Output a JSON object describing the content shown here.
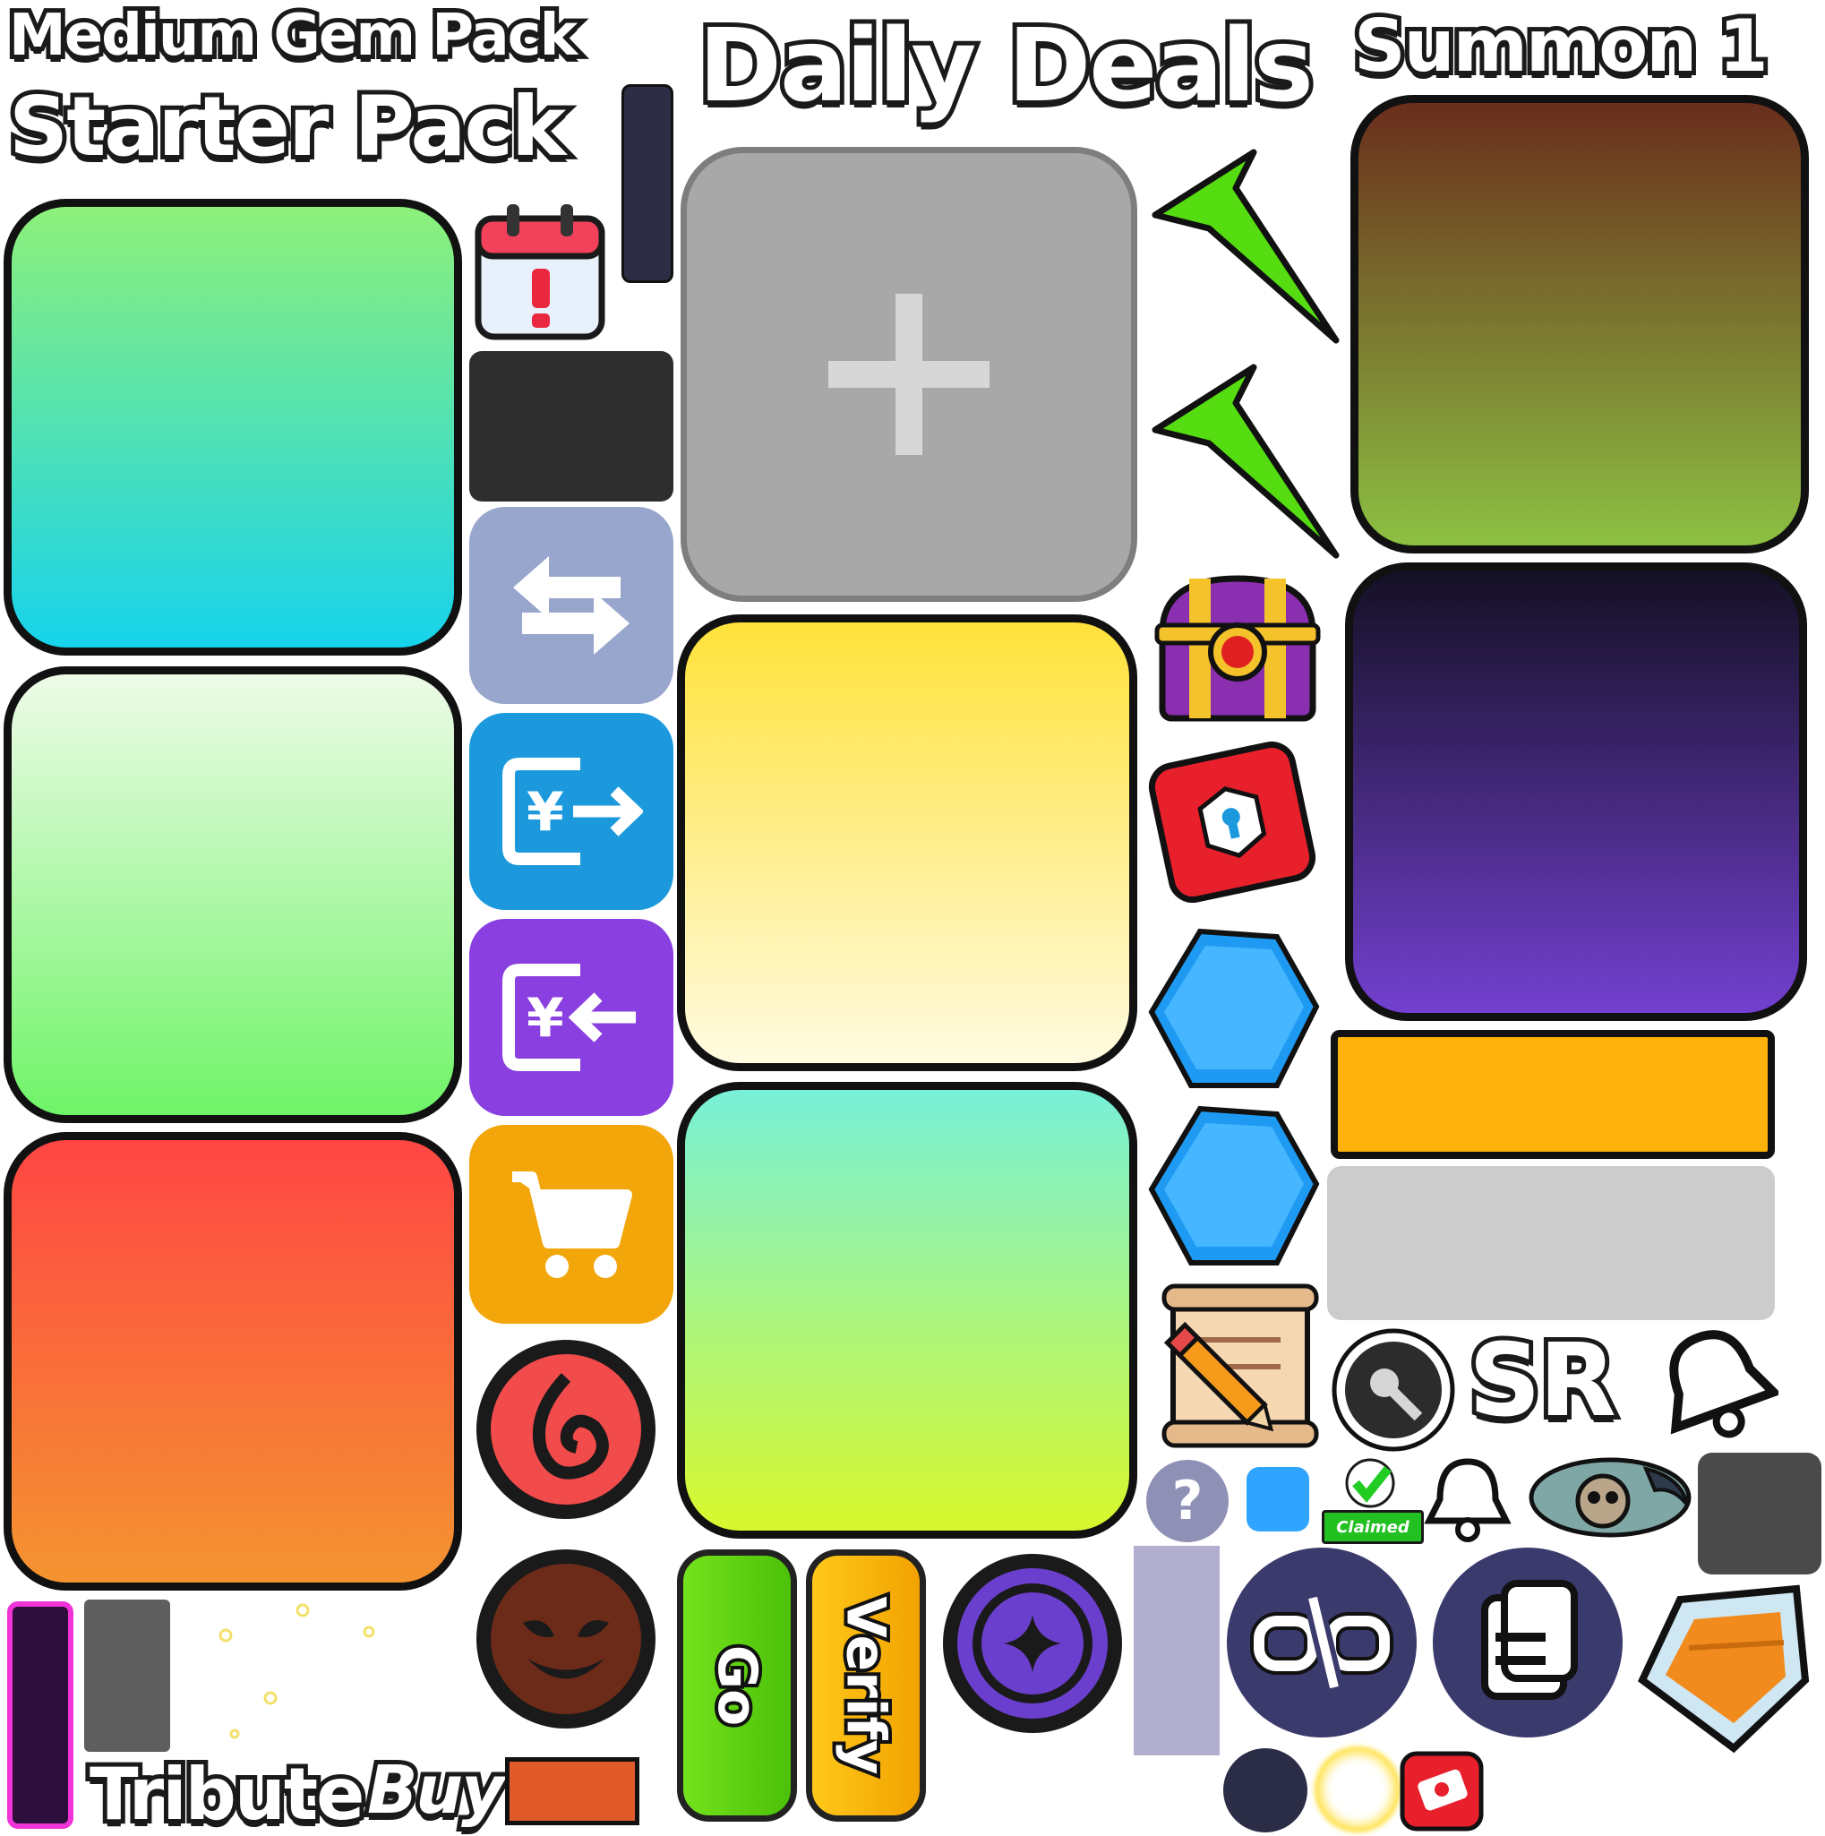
{
  "titles": {
    "medium_gem_pack": "Medium Gem Pack",
    "starter_pack": "Starter Pack",
    "daily_deals": "Daily Deals",
    "summon_1": "Summon 1",
    "tribute": "Tribute",
    "buy": "Buy",
    "sr": "SR"
  },
  "buttons": {
    "go": "Go",
    "verify": "Verify"
  },
  "badges": {
    "claimed": "Claimed",
    "help": "?"
  },
  "colors": {
    "card_green_cyan": [
      "#8df07a",
      "#16d3ec"
    ],
    "card_mint_green": [
      "#eefbe8",
      "#6ff468"
    ],
    "card_red_orange": [
      "#ff4644",
      "#f49430"
    ],
    "card_yellow": [
      "#ffe23a",
      "#fffbe0"
    ],
    "card_teal_lime": [
      "#78f0d8",
      "#d8f82c"
    ],
    "card_brown_olive": [
      "#6a2e1c",
      "#8cc042"
    ],
    "card_dark_purple": [
      "#141024",
      "#7240d0"
    ],
    "orange_bar": "#ffb20c",
    "grey_bar": "#cccccc",
    "plus_tile": "#a8a8a8",
    "green_arrow": "#55dd11"
  },
  "icons": [
    "calendar-alert-icon",
    "swap-arrows-icon",
    "yen-exit-icon",
    "yen-enter-icon",
    "shopping-cart-icon",
    "fire-swirl-icon",
    "demon-face-icon",
    "treasure-chest-icon",
    "red-lock-icon",
    "blue-hexagon-gem-icon",
    "scroll-pencil-icon",
    "key-icon",
    "bell-icon",
    "check-icon",
    "moon-star-icon",
    "unlink-icon",
    "document-icon",
    "orange-gem-icon",
    "ticket-skull-icon",
    "plus-icon",
    "green-arrow-icon"
  ]
}
